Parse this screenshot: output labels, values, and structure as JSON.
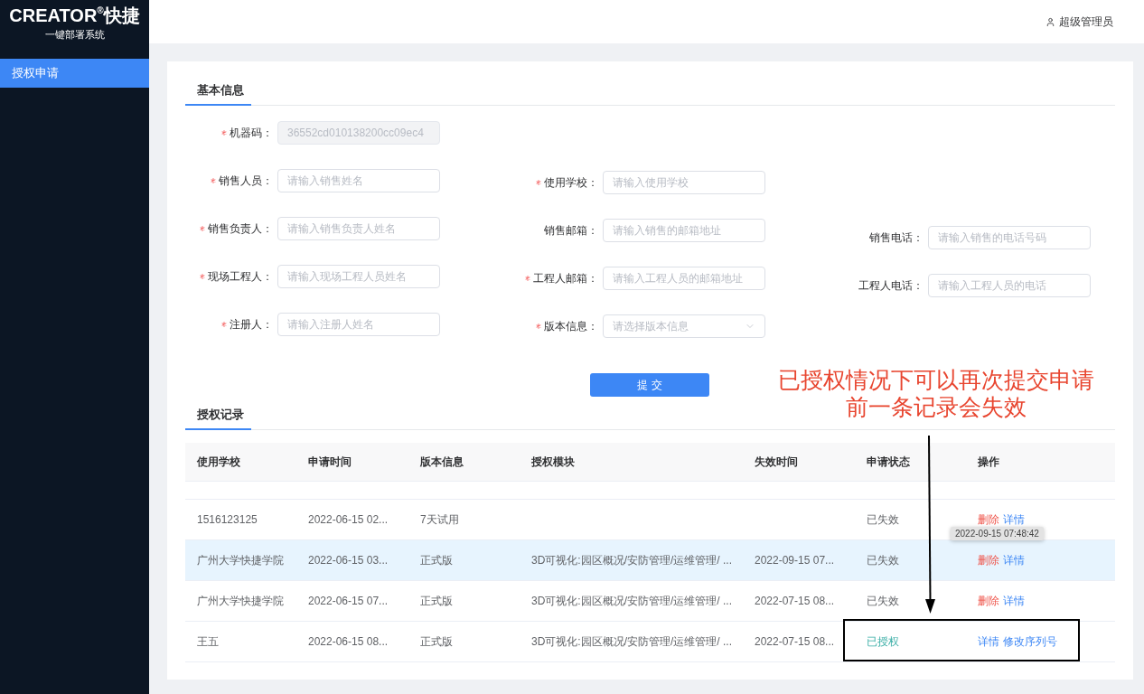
{
  "sidebar": {
    "logo_title": "CREATOR$^{®}$快捷",
    "logo_subtitle": "一键部署系统",
    "items": [
      {
        "label": "授权申请",
        "selected": true
      }
    ]
  },
  "header": {
    "user": "超级管理员"
  },
  "info_tab": {
    "label": "基本信息",
    "selected": true
  },
  "form": {
    "rows": [
      [
        {
          "label": "机器码：",
          "required": true,
          "kind": "input",
          "value": "36552cd010138200cc09ec4",
          "disabled": true
        }
      ],
      [
        {
          "label": "销售人员：",
          "required": true,
          "kind": "input",
          "placeholder": "请输入销售姓名",
          "disabled": false
        },
        {
          "label": "使用学校：",
          "required": true,
          "kind": "input",
          "placeholder": "请输入使用学校",
          "disabled": false
        }
      ],
      [
        {
          "label": "销售负责人：",
          "required": true,
          "kind": "input",
          "placeholder": "请输入销售负责人姓名",
          "disabled": false
        },
        {
          "label": "销售邮箱：",
          "required": false,
          "kind": "input",
          "placeholder": "请输入销售的邮箱地址",
          "disabled": false
        },
        {
          "label": "销售电话：",
          "required": false,
          "kind": "input",
          "placeholder": "请输入销售的电话号码",
          "disabled": false
        }
      ],
      [
        {
          "label": "现场工程人：",
          "required": true,
          "kind": "input",
          "placeholder": "请输入现场工程人员姓名",
          "disabled": false
        },
        {
          "label": "工程人邮箱：",
          "required": true,
          "kind": "input",
          "placeholder": "请输入工程人员的邮箱地址",
          "disabled": false
        },
        {
          "label": "工程人电话：",
          "required": false,
          "kind": "input",
          "placeholder": "请输入工程人员的电话",
          "disabled": false
        }
      ],
      [
        {
          "label": "注册人：",
          "required": true,
          "kind": "input",
          "placeholder": "请输入注册人姓名",
          "disabled": false
        },
        {
          "label": "版本信息：",
          "required": true,
          "kind": "select",
          "placeholder": "请选择版本信息",
          "disabled": false
        }
      ]
    ],
    "submit": "提 交"
  },
  "annotation": "已授权情况下可以再次提交申请前一条记录会失效",
  "records_tab": {
    "label": "授权记录",
    "selected": true
  },
  "table": {
    "columns": [
      "使用学校",
      "申请时间",
      "版本信息",
      "授权模块",
      "失效时间",
      "申请状态",
      "操作"
    ],
    "rows": [
      {
        "cells": {
          "school": "1516123125",
          "applied_at": "2022-06-15 02...",
          "version": "7天试用"
        },
        "status": {
          "text": "已失效",
          "kind": "expired"
        },
        "actions": [
          {
            "label": "删除",
            "kind": "delete"
          },
          {
            "label": "详情",
            "kind": "link"
          }
        ],
        "highlighted": false,
        "framed": false
      },
      {
        "cells": {
          "school": "广州大学快捷学院",
          "applied_at": "2022-06-15 03...",
          "version": "正式版",
          "modules": "3D可视化:园区概况/安防管理/运维管理/ ...",
          "expires_at": "2022-09-15 07..."
        },
        "status": {
          "text": "已失效",
          "kind": "expired"
        },
        "actions": [
          {
            "label": "删除",
            "kind": "delete"
          },
          {
            "label": "详情",
            "kind": "link"
          }
        ],
        "highlighted": true,
        "framed": false
      },
      {
        "cells": {
          "school": "广州大学快捷学院",
          "applied_at": "2022-06-15 07...",
          "version": "正式版",
          "modules": "3D可视化:园区概况/安防管理/运维管理/ ...",
          "expires_at": "2022-07-15 08..."
        },
        "status": {
          "text": "已失效",
          "kind": "expired"
        },
        "actions": [
          {
            "label": "删除",
            "kind": "delete"
          },
          {
            "label": "详情",
            "kind": "link"
          }
        ],
        "highlighted": false,
        "framed": false
      },
      {
        "cells": {
          "school": "王五",
          "applied_at": "2022-06-15 08...",
          "version": "正式版",
          "modules": "3D可视化:园区概况/安防管理/运维管理/ ...",
          "expires_at": "2022-07-15 08..."
        },
        "status": {
          "text": "已授权",
          "kind": "authorized"
        },
        "actions": [
          {
            "label": "详情",
            "kind": "link"
          },
          {
            "label": "修改序列号",
            "kind": "link"
          }
        ],
        "highlighted": false,
        "framed": true
      }
    ]
  },
  "tooltip": "2022-09-15 07:48:42"
}
